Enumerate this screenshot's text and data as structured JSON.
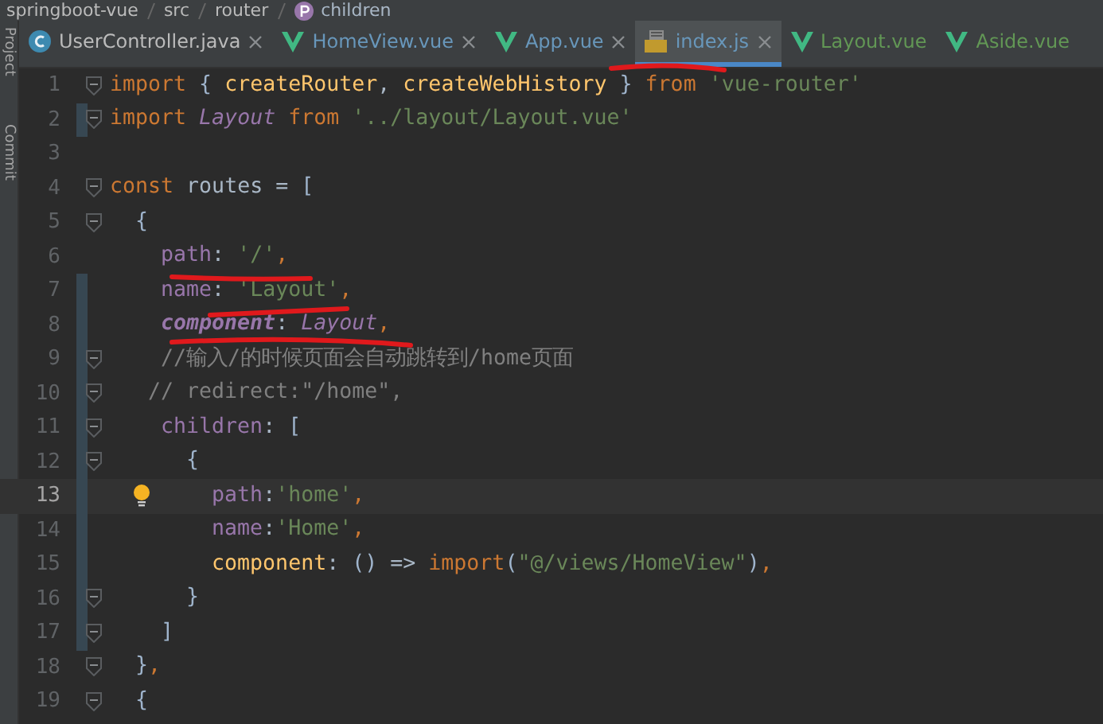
{
  "breadcrumb": [
    {
      "kind": "folder",
      "text": "springboot-vue"
    },
    {
      "kind": "folder",
      "text": "src"
    },
    {
      "kind": "folder",
      "text": "router"
    },
    {
      "kind": "property",
      "text": "children"
    }
  ],
  "tool_strip": [
    "Project",
    "Commit"
  ],
  "tabs": [
    {
      "label": "UserController.java",
      "kind": "java",
      "color": "#bbbbbb",
      "selected": false,
      "closable": true
    },
    {
      "label": "HomeView.vue",
      "kind": "vue",
      "color": "#6897bb",
      "selected": false,
      "closable": true
    },
    {
      "label": "App.vue",
      "kind": "vue",
      "color": "#6897bb",
      "selected": false,
      "closable": true
    },
    {
      "label": "index.js",
      "kind": "js",
      "color": "#6897bb",
      "selected": true,
      "closable": true
    },
    {
      "label": "Layout.vue",
      "kind": "vue",
      "color": "#629755",
      "selected": false,
      "closable": false
    },
    {
      "label": "Aside.vue",
      "kind": "vue",
      "color": "#629755",
      "selected": false,
      "closable": false
    }
  ],
  "editor": {
    "lines": [
      {
        "number": "1",
        "fold": true,
        "changed": false,
        "current": false,
        "hint": false,
        "tokens": [
          {
            "kind": "keyword",
            "text": "import"
          },
          {
            "kind": "brace",
            "text": " { "
          },
          {
            "kind": "func",
            "text": "createRouter"
          },
          {
            "kind": "plain",
            "text": ", "
          },
          {
            "kind": "func",
            "text": "createWebHistory"
          },
          {
            "kind": "brace",
            "text": " } "
          },
          {
            "kind": "keyword",
            "text": "from "
          },
          {
            "kind": "string",
            "text": "'vue-router'"
          }
        ]
      },
      {
        "number": "2",
        "fold": true,
        "changed": true,
        "current": false,
        "hint": false,
        "tokens": [
          {
            "kind": "keyword",
            "text": "import "
          },
          {
            "kind": "class",
            "text": "Layout"
          },
          {
            "kind": "keyword",
            "text": " from "
          },
          {
            "kind": "string",
            "text": "'../layout/Layout.vue'"
          }
        ]
      },
      {
        "number": "3",
        "fold": false,
        "changed": false,
        "current": false,
        "hint": false
      },
      {
        "number": "4",
        "fold": true,
        "changed": false,
        "current": false,
        "hint": false,
        "tokens": [
          {
            "kind": "keyword",
            "text": "const "
          },
          {
            "kind": "plain",
            "text": "routes = "
          },
          {
            "kind": "brace",
            "text": "["
          }
        ]
      },
      {
        "number": "5",
        "fold": true,
        "changed": false,
        "current": false,
        "hint": false,
        "tokens": [
          {
            "kind": "brace",
            "text": "  {"
          }
        ]
      },
      {
        "number": "6",
        "fold": false,
        "changed": false,
        "current": false,
        "hint": false,
        "tokens": [
          {
            "kind": "property",
            "text": "    path"
          },
          {
            "kind": "plain",
            "text": ": "
          },
          {
            "kind": "string",
            "text": "'/'"
          },
          {
            "kind": "keyword",
            "text": ","
          }
        ]
      },
      {
        "number": "7",
        "fold": false,
        "changed": true,
        "current": false,
        "hint": false,
        "tokens": [
          {
            "kind": "property",
            "text": "    name"
          },
          {
            "kind": "plain",
            "text": ": "
          },
          {
            "kind": "string",
            "text": "'Layout'"
          },
          {
            "kind": "keyword",
            "text": ","
          }
        ]
      },
      {
        "number": "8",
        "fold": false,
        "changed": true,
        "current": false,
        "hint": false,
        "tokens": [
          {
            "kind": "property-bold",
            "text": "    component"
          },
          {
            "kind": "plain",
            "text": ": "
          },
          {
            "kind": "class",
            "text": "Layout"
          },
          {
            "kind": "keyword",
            "text": ","
          }
        ]
      },
      {
        "number": "9",
        "fold": true,
        "changed": true,
        "current": false,
        "hint": false,
        "tokens": [
          {
            "kind": "comment",
            "text": "    //输入/的时候页面会自动跳转到/home页面"
          }
        ]
      },
      {
        "number": "10",
        "fold": true,
        "changed": true,
        "current": false,
        "hint": false,
        "tokens": [
          {
            "kind": "comment",
            "text": "   // redirect:\"/home\","
          }
        ]
      },
      {
        "number": "11",
        "fold": true,
        "changed": true,
        "current": false,
        "hint": false,
        "tokens": [
          {
            "kind": "property",
            "text": "    children"
          },
          {
            "kind": "plain",
            "text": ": "
          },
          {
            "kind": "brace",
            "text": "["
          }
        ]
      },
      {
        "number": "12",
        "fold": true,
        "changed": true,
        "current": false,
        "hint": false,
        "tokens": [
          {
            "kind": "brace",
            "text": "      {"
          }
        ]
      },
      {
        "number": "13",
        "fold": false,
        "changed": true,
        "current": true,
        "hint": true,
        "tokens": [
          {
            "kind": "property",
            "text": "        path"
          },
          {
            "kind": "plain",
            "text": ":"
          },
          {
            "kind": "string",
            "text": "'home'"
          },
          {
            "kind": "keyword",
            "text": ","
          }
        ]
      },
      {
        "number": "14",
        "fold": false,
        "changed": true,
        "current": false,
        "hint": false,
        "tokens": [
          {
            "kind": "property",
            "text": "        name"
          },
          {
            "kind": "plain",
            "text": ":"
          },
          {
            "kind": "string",
            "text": "'Home'"
          },
          {
            "kind": "keyword",
            "text": ","
          }
        ]
      },
      {
        "number": "15",
        "fold": false,
        "changed": true,
        "current": false,
        "hint": false,
        "tokens": [
          {
            "kind": "func",
            "text": "        component"
          },
          {
            "kind": "plain",
            "text": ": "
          },
          {
            "kind": "brace",
            "text": "()"
          },
          {
            "kind": "plain",
            "text": " => "
          },
          {
            "kind": "keyword",
            "text": "import"
          },
          {
            "kind": "brace",
            "text": "("
          },
          {
            "kind": "string",
            "text": "\"@/views/HomeView\""
          },
          {
            "kind": "brace",
            "text": ")"
          },
          {
            "kind": "keyword",
            "text": ","
          }
        ]
      },
      {
        "number": "16",
        "fold": true,
        "changed": true,
        "current": false,
        "hint": false,
        "tokens": [
          {
            "kind": "brace",
            "text": "      }"
          }
        ]
      },
      {
        "number": "17",
        "fold": true,
        "changed": true,
        "current": false,
        "hint": false,
        "tokens": [
          {
            "kind": "brace",
            "text": "    ]"
          }
        ]
      },
      {
        "number": "18",
        "fold": true,
        "changed": false,
        "current": false,
        "hint": false,
        "tokens": [
          {
            "kind": "brace",
            "text": "  }"
          },
          {
            "kind": "keyword",
            "text": ","
          }
        ]
      },
      {
        "number": "19",
        "fold": true,
        "changed": false,
        "current": false,
        "hint": false,
        "tokens": [
          {
            "kind": "brace",
            "text": "  {"
          }
        ]
      }
    ]
  }
}
